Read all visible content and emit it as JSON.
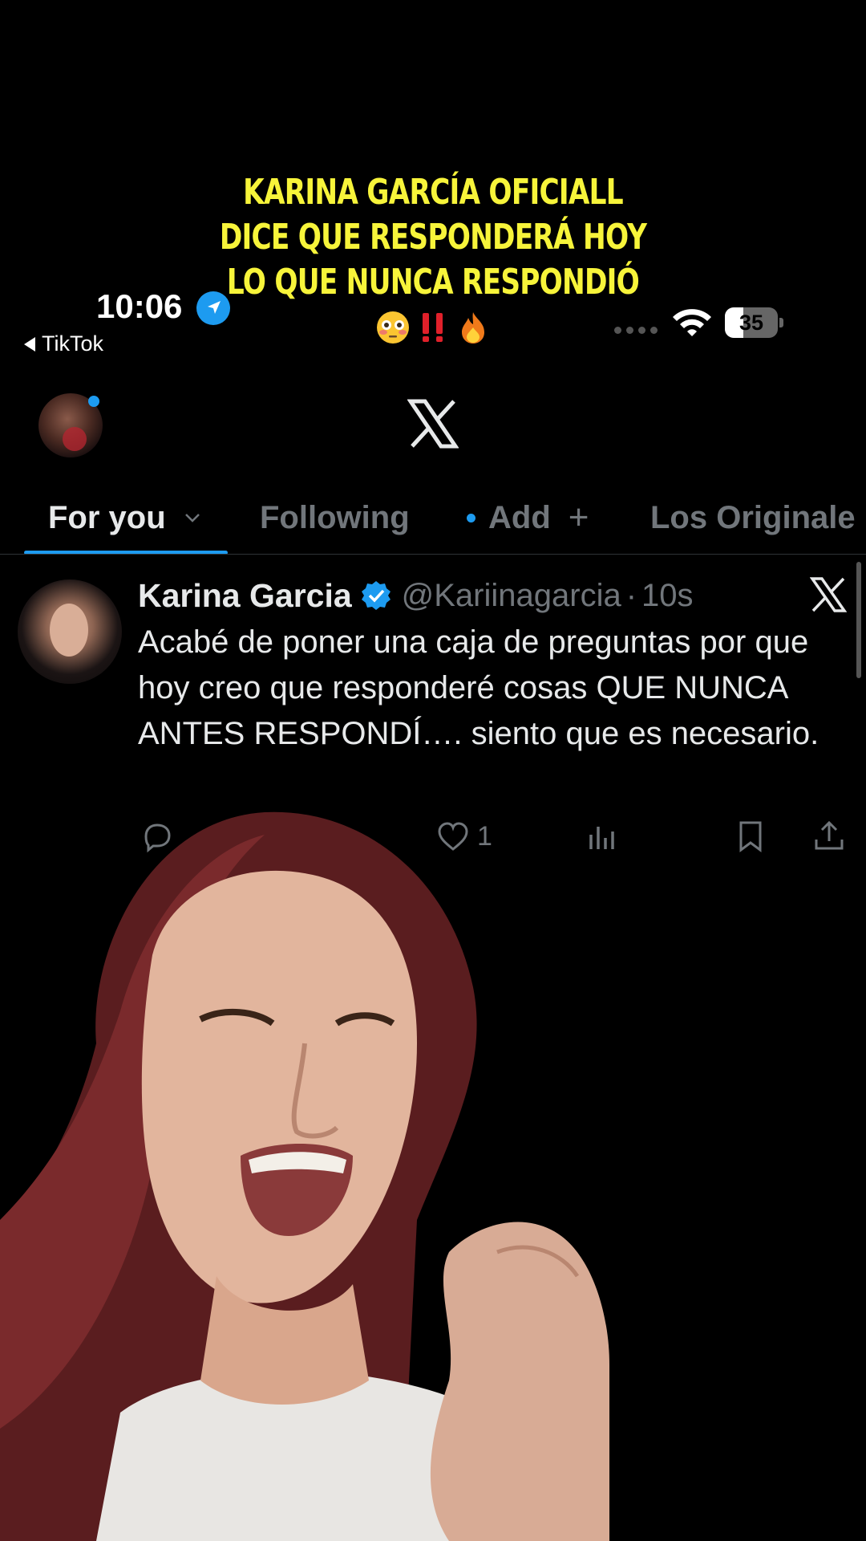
{
  "caption": {
    "lines": [
      "KARINA GARCÍA OFICIALL",
      "DICE QUE RESPONDERÁ HOY",
      "LO QUE NUNCA RESPONDIÓ"
    ],
    "emoji": [
      "😳",
      "‼️",
      "🔥"
    ]
  },
  "status_bar": {
    "time": "10:06",
    "back_app": "TikTok",
    "battery_level": "35",
    "battery_percent": 35,
    "icons": [
      "location-arrow-icon",
      "signal-dots-icon",
      "wifi-icon",
      "battery-icon"
    ]
  },
  "header": {
    "logo": "x-logo",
    "avatar": "profile-avatar"
  },
  "tabs": [
    {
      "label": "For you",
      "active": true
    },
    {
      "label": "Following",
      "active": false
    },
    {
      "label": "Add",
      "active": false
    },
    {
      "label": "Los Originale",
      "active": false
    }
  ],
  "tweet": {
    "author_name": "Karina Garcia",
    "handle": "@Kariinagarcia",
    "separator": "·",
    "time": "10s",
    "text": "Acabé de poner una caja de preguntas por que hoy creo que responderé cosas QUE NUNCA ANTES RESPONDÍ…. siento que es necesario.",
    "likes": "1",
    "actions": [
      "reply-icon",
      "like-icon",
      "views-icon",
      "bookmark-icon",
      "share-icon"
    ]
  },
  "colors": {
    "background": "#000000",
    "caption_yellow": "#f7f43a",
    "accent_blue": "#1d9bf0",
    "text_primary": "#e7e9ea",
    "text_secondary": "#71767b"
  }
}
